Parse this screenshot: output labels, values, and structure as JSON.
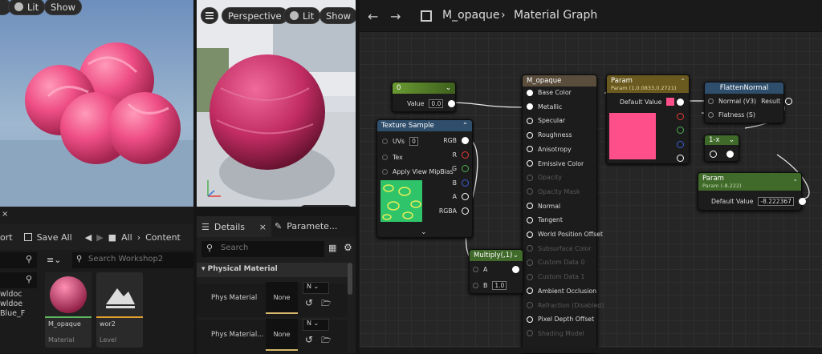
{
  "viewport_left": {
    "lit": "Lit",
    "show": "Show"
  },
  "viewport_preview": {
    "perspective": "Perspective",
    "lit": "Lit",
    "show": "Show"
  },
  "graph_header": {
    "asset": "M_opaque",
    "section": "Material Graph"
  },
  "nodes": {
    "const": {
      "title": "0",
      "value_label": "Value",
      "value": "0.0"
    },
    "texture": {
      "title": "Texture Sample",
      "inputs": [
        "UVs",
        "Tex",
        "Apply View MipBias"
      ],
      "uvs_value": "0",
      "outputs": [
        "RGB",
        "R",
        "G",
        "B",
        "A",
        "RGBA"
      ]
    },
    "material": {
      "title": "M_opaque",
      "pins_active": [
        "Base Color",
        "Metallic",
        "Specular",
        "Roughness",
        "Anisotropy",
        "Emissive Color"
      ],
      "pins_dim1": [
        "Opacity",
        "Opacity Mask"
      ],
      "pins_active2": [
        "Normal",
        "Tangent",
        "World Position Offset"
      ],
      "pins_dim2": [
        "Subsurface Color",
        "Custom Data 0",
        "Custom Data 1"
      ],
      "pins_active3": [
        "Ambient Occlusion"
      ],
      "pins_dim3": [
        "Refraction (Disabled)"
      ],
      "pins_active4": [
        "Pixel Depth Offset"
      ],
      "pins_dim4": [
        "Shading Model"
      ]
    },
    "param_color": {
      "title": "Param",
      "subtitle": "Param (1,0.0833,0.2721)",
      "label": "Default Value",
      "color": "#ff4f8b"
    },
    "flatten": {
      "title": "FlattenNormal",
      "input1": "Normal (V3)",
      "output": "Result",
      "input2": "Flatness (S)"
    },
    "oneminus": {
      "title": "1-x"
    },
    "param_scalar": {
      "title": "Param",
      "subtitle": "Param (-8.222)",
      "label": "Default Value",
      "value": "-8.222367"
    },
    "multiply": {
      "title": "Multiply(,1)",
      "a": "A",
      "b": "B",
      "b_value": "1.0"
    }
  },
  "content_browser": {
    "save_all": "Save All",
    "all": "All",
    "content": "Content",
    "ort": "ort",
    "search_placeholder": "Search Workshop2",
    "items_left": [
      "wldoc",
      "wldoe",
      "Blue_F"
    ],
    "assets": [
      {
        "name": "M_opaque",
        "type": "Material"
      },
      {
        "name": "wor2",
        "type": "Level"
      }
    ]
  },
  "details": {
    "tab1": "Details",
    "tab2": "Paramete...",
    "search_placeholder": "Search",
    "section": "Physical Material",
    "rows": [
      {
        "label": "Phys Material",
        "value": "None",
        "combo": "N"
      },
      {
        "label": "Phys Material...",
        "value": "None",
        "combo": "N"
      }
    ]
  },
  "colors": {
    "accent_green": "#7aa83c",
    "texture_blue": "#2f4e6b",
    "material_brown": "#5a4d3c",
    "pink": "#ff4f8b"
  }
}
